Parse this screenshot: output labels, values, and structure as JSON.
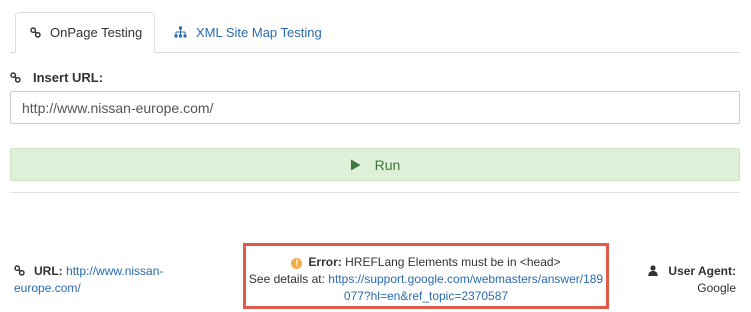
{
  "tabs": [
    {
      "label": "OnPage Testing",
      "icon": "link-icon",
      "active": true
    },
    {
      "label": "XML Site Map Testing",
      "icon": "sitemap-icon",
      "active": false
    }
  ],
  "form": {
    "insert_url_label": "Insert URL:",
    "url_value": "http://www.nissan-europe.com/",
    "run_label": "Run"
  },
  "result": {
    "url_label": "URL:",
    "url_value": "http://www.nissan-europe.com/",
    "error_label": "Error:",
    "error_message": "HREFLang Elements must be in <head>",
    "details_prefix": "See details at:",
    "details_link": "https://support.google.com/webmasters/answer/189077?hl=en&ref_topic=2370587",
    "user_agent_label": "User Agent:",
    "user_agent_value": "Google"
  },
  "colors": {
    "link": "#2a6bb0",
    "run_bg": "#dff0d8",
    "run_text": "#3c763d",
    "error_border": "#e0594a",
    "warning": "#f0ad4e"
  }
}
